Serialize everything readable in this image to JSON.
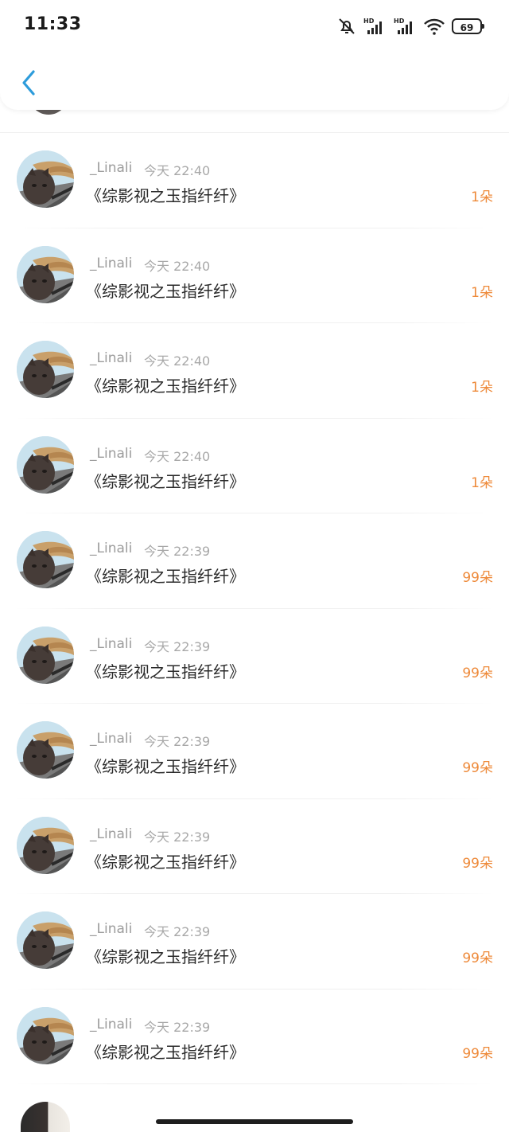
{
  "status_bar": {
    "time": "11:33",
    "battery": "69",
    "icons": [
      "mute-bell-icon",
      "hd-signal-icon",
      "hd-signal-icon",
      "wifi-icon",
      "battery-icon"
    ]
  },
  "header": {
    "back_icon": "chevron-left-icon",
    "accent_color": "#2d9cdb"
  },
  "list": {
    "amount_color": "#ee8a3a",
    "items": [
      {
        "username": "_Linali",
        "time": "今天 22:40",
        "book": "《综影视之玉指纤纤》",
        "amount": "1朵"
      },
      {
        "username": "_Linali",
        "time": "今天 22:40",
        "book": "《综影视之玉指纤纤》",
        "amount": "1朵"
      },
      {
        "username": "_Linali",
        "time": "今天 22:40",
        "book": "《综影视之玉指纤纤》",
        "amount": "1朵"
      },
      {
        "username": "_Linali",
        "time": "今天 22:40",
        "book": "《综影视之玉指纤纤》",
        "amount": "1朵"
      },
      {
        "username": "_Linali",
        "time": "今天 22:39",
        "book": "《综影视之玉指纤纤》",
        "amount": "99朵"
      },
      {
        "username": "_Linali",
        "time": "今天 22:39",
        "book": "《综影视之玉指纤纤》",
        "amount": "99朵"
      },
      {
        "username": "_Linali",
        "time": "今天 22:39",
        "book": "《综影视之玉指纤纤》",
        "amount": "99朵"
      },
      {
        "username": "_Linali",
        "time": "今天 22:39",
        "book": "《综影视之玉指纤纤》",
        "amount": "99朵"
      },
      {
        "username": "_Linali",
        "time": "今天 22:39",
        "book": "《综影视之玉指纤纤》",
        "amount": "99朵"
      },
      {
        "username": "_Linali",
        "time": "今天 22:39",
        "book": "《综影视之玉指纤纤》",
        "amount": "99朵"
      }
    ]
  }
}
